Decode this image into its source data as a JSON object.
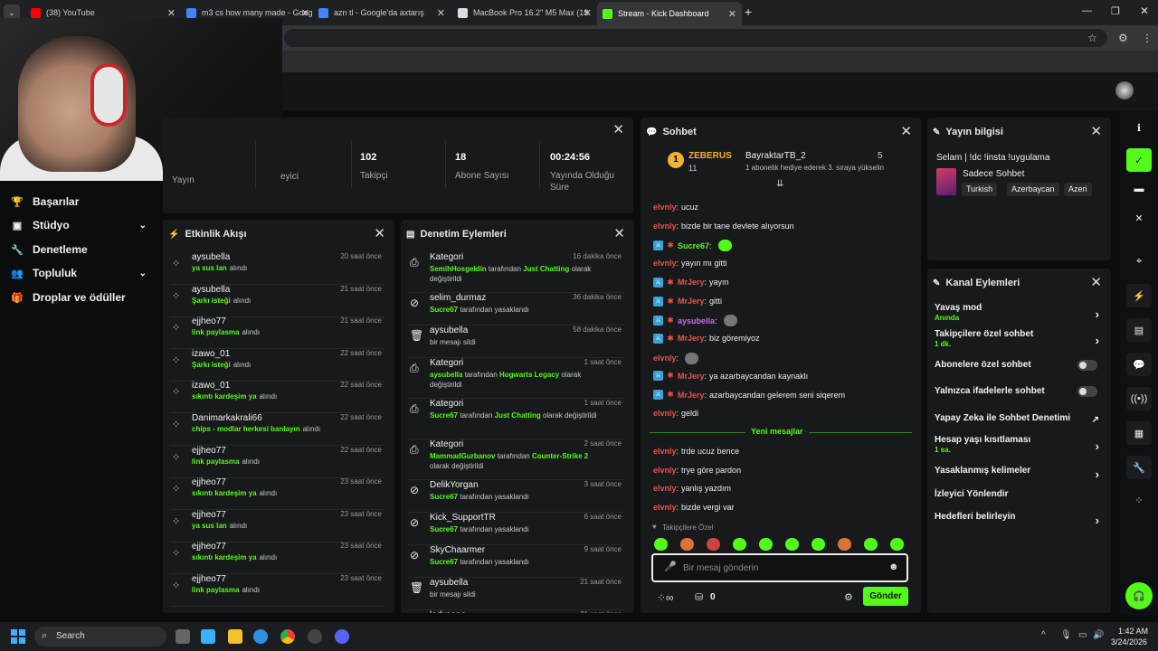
{
  "browser": {
    "tabs": [
      {
        "title": "(38) YouTube",
        "color": "#ff0000"
      },
      {
        "title": "m3 cs how many made - Goog",
        "color": "#4285f4"
      },
      {
        "title": "azn tl - Google'da axtarış",
        "color": "#4285f4"
      },
      {
        "title": "MacBook Pro 16.2\" M5 Max (18",
        "color": "#dddddd"
      },
      {
        "title": "Stream - Kick Dashboard",
        "color": "#53fc18"
      }
    ],
    "new_tab": "+"
  },
  "nav": {
    "items": [
      {
        "label": "Başarılar",
        "icon": "trophy-icon"
      },
      {
        "label": "Stüdyo",
        "icon": "studio-icon"
      },
      {
        "label": "Denetleme",
        "icon": "wrench-icon"
      },
      {
        "label": "Topluluk",
        "icon": "users-icon"
      },
      {
        "label": "Droplar ve ödüller",
        "icon": "gift-icon"
      }
    ]
  },
  "stats": {
    "partial_label_1": "Yayın",
    "partial_label_2": "eyici",
    "items": [
      {
        "value": "102",
        "label": "Takipçi"
      },
      {
        "value": "18",
        "label": "Abone Sayısı"
      },
      {
        "value": "00:24:56",
        "label": "Yayında Olduğu Süre"
      }
    ]
  },
  "activity": {
    "title": "Etkinlik Akışı",
    "rows": [
      {
        "name": "aysubella",
        "time": "20 saat önce",
        "detail": "ya sus lan",
        "suffix": "alındı"
      },
      {
        "name": "aysubella",
        "time": "21 saat önce",
        "detail": "Şarkı isteği",
        "suffix": "alındı"
      },
      {
        "name": "ejjheo77",
        "time": "21 saat önce",
        "detail": "link paylasma",
        "suffix": "alındı"
      },
      {
        "name": "izawo_01",
        "time": "22 saat önce",
        "detail": "Şarkı isteği",
        "suffix": "alındı"
      },
      {
        "name": "izawo_01",
        "time": "22 saat önce",
        "detail": "sıkıntı kardeşim ya",
        "suffix": "alındı"
      },
      {
        "name": "Danimarkakrali66",
        "time": "22 saat önce",
        "detail": "chips - modlar herkesi banlayın",
        "suffix": "alındı"
      },
      {
        "name": "ejjheo77",
        "time": "22 saat önce",
        "detail": "link paylasma",
        "suffix": "alındı"
      },
      {
        "name": "ejjheo77",
        "time": "23 saat önce",
        "detail": "sıkıntı kardeşim ya",
        "suffix": "alındı"
      },
      {
        "name": "ejjheo77",
        "time": "23 saat önce",
        "detail": "ya sus lan",
        "suffix": "alındı"
      },
      {
        "name": "ejjheo77",
        "time": "23 saat önce",
        "detail": "sıkıntı kardeşim ya",
        "suffix": "alındı"
      },
      {
        "name": "ejjheo77",
        "time": "23 saat önce",
        "detail": "link paylasma",
        "suffix": "alındı"
      }
    ]
  },
  "moderation": {
    "title": "Denetim Eylemleri",
    "rows": [
      {
        "name": "Kategori",
        "time": "16 dakika önce",
        "icon": "category-icon",
        "parts": [
          [
            "SemihHosgeldin",
            1
          ],
          [
            " tarafından ",
            0
          ],
          [
            "Just Chatting",
            1
          ],
          [
            " olarak değiştirildi",
            0
          ]
        ]
      },
      {
        "name": "selim_durmaz",
        "time": "36 dakika önce",
        "icon": "ban-icon",
        "parts": [
          [
            "Sucre67",
            1
          ],
          [
            " tarafından yasaklandı",
            0
          ]
        ]
      },
      {
        "name": "aysubella",
        "time": "58 dakika önce",
        "icon": "trash-icon",
        "parts": [
          [
            "bir mesajı sildi",
            0
          ]
        ]
      },
      {
        "name": "Kategori",
        "time": "1 saat önce",
        "icon": "category-icon",
        "parts": [
          [
            "aysubella",
            1
          ],
          [
            " tarafından ",
            0
          ],
          [
            "Hogwarts Legacy",
            1
          ],
          [
            " olarak değiştirildi",
            0
          ]
        ]
      },
      {
        "name": "Kategori",
        "time": "1 saat önce",
        "icon": "category-icon",
        "parts": [
          [
            "Sucre67",
            1
          ],
          [
            " tarafından ",
            0
          ],
          [
            "Just Chatting",
            1
          ],
          [
            " olarak değiştirildi",
            0
          ]
        ]
      },
      {
        "name": "Kategori",
        "time": "2 saat önce",
        "icon": "category-icon",
        "parts": [
          [
            "MammadGurbanov",
            1
          ],
          [
            " tarafından ",
            0
          ],
          [
            "Counter-Strike 2",
            1
          ],
          [
            " olarak değiştirildi",
            0
          ]
        ]
      },
      {
        "name": "DelikYorgan",
        "time": "3 saat önce",
        "icon": "ban-icon",
        "parts": [
          [
            "Sucre67",
            1
          ],
          [
            " tarafından yasaklandı",
            0
          ]
        ]
      },
      {
        "name": "Kick_SupportTR",
        "time": "6 saat önce",
        "icon": "ban-icon",
        "parts": [
          [
            "Sucre67",
            1
          ],
          [
            " tarafından yasaklandı",
            0
          ]
        ]
      },
      {
        "name": "SkyChaarmer",
        "time": "9 saat önce",
        "icon": "ban-icon",
        "parts": [
          [
            "Sucre67",
            1
          ],
          [
            " tarafından yasaklandı",
            0
          ]
        ]
      },
      {
        "name": "aysubella",
        "time": "21 saat önce",
        "icon": "trash-icon",
        "parts": [
          [
            "bir mesajı sildi",
            0
          ]
        ]
      },
      {
        "name": "ladysona",
        "time": "21 saat önce",
        "icon": "trash-icon",
        "parts": []
      }
    ]
  },
  "chat": {
    "title": "Sohbet",
    "leader": {
      "rank": "1",
      "name": "ZEBERUS",
      "count": "11"
    },
    "second": {
      "name": "BayraktarTB_2",
      "count": "5",
      "note": "1 abonelik hediye ederek 3. sıraya yükselin"
    },
    "messages": [
      {
        "user": "elvnly",
        "text": "ucuz"
      },
      {
        "user": "elvnly",
        "text": "bizde bir tane devlete alıyorsun"
      },
      {
        "user": "Sucre67",
        "text": "",
        "mod": true,
        "emote": true
      },
      {
        "user": "elvnly",
        "text": "yayın mı gitti"
      },
      {
        "user": "MrJery",
        "text": "yayın",
        "mod": true
      },
      {
        "user": "MrJery",
        "text": "gitti",
        "mod": true
      },
      {
        "user": "aysubella",
        "text": "",
        "mod": true,
        "emote": true
      },
      {
        "user": "MrJery",
        "text": "biz göremiyoz",
        "mod": true
      },
      {
        "user": "elvnly",
        "text": "",
        "emote": true
      },
      {
        "user": "MrJery",
        "text": "ya azarbaycandan kaynaklı",
        "mod": true
      },
      {
        "user": "MrJery",
        "text": "azarbaycandan gelerem seni siqerem",
        "mod": true
      },
      {
        "user": "elvnly",
        "text": "geldi"
      }
    ],
    "new_messages": "Yeni mesajlar",
    "new": [
      {
        "user": "elvnly",
        "text": "trde ucuz bence"
      },
      {
        "user": "elvnly",
        "text": "trye göre pardon"
      },
      {
        "user": "elvnly",
        "text": "yanlış yazdım"
      },
      {
        "user": "elvnly",
        "text": "bizde vergi var"
      }
    ],
    "follower_only": "Takipçilere Özel",
    "placeholder": "Bir mesaj gönderin",
    "points": "0",
    "send": "Gönder"
  },
  "stream_info": {
    "title": "Yayın bilgisi",
    "stream_title": "Selam | !dc !insta !uygulama",
    "category": "Sadece Sohbet",
    "tags": [
      "Turkish",
      "Azerbaycan",
      "Azeri"
    ]
  },
  "channel_actions": {
    "title": "Kanal Eylemleri",
    "items": [
      {
        "label": "Yavaş mod",
        "sub": "Anında",
        "control": "chevron"
      },
      {
        "label": "Takipçilere özel sohbet",
        "sub": "1 dk.",
        "control": "chevron"
      },
      {
        "label": "Abonelere özel sohbet",
        "sub": "",
        "control": "toggle"
      },
      {
        "label": "Yalnızca ifadelerle sohbet",
        "sub": "",
        "control": "toggle"
      },
      {
        "label": "Yapay Zeka ile Sohbet Denetimi",
        "sub": "",
        "control": "external"
      },
      {
        "label": "Hesap yaşı kısıtlaması",
        "sub": "1 sa.",
        "control": "chevron"
      },
      {
        "label": "Yasaklanmış kelimeler",
        "sub": "",
        "control": "chevron"
      },
      {
        "label": "İzleyici Yönlendir",
        "sub": "",
        "control": "none"
      },
      {
        "label": "Hedefleri belirleyin",
        "sub": "",
        "control": "chevron"
      }
    ]
  },
  "taskbar": {
    "search": "Search",
    "time": "1:42 AM",
    "date": "3/24/2026"
  },
  "colors": {
    "accent": "#53fc18",
    "panel": "#18191b",
    "background": "#0b0c0e"
  }
}
